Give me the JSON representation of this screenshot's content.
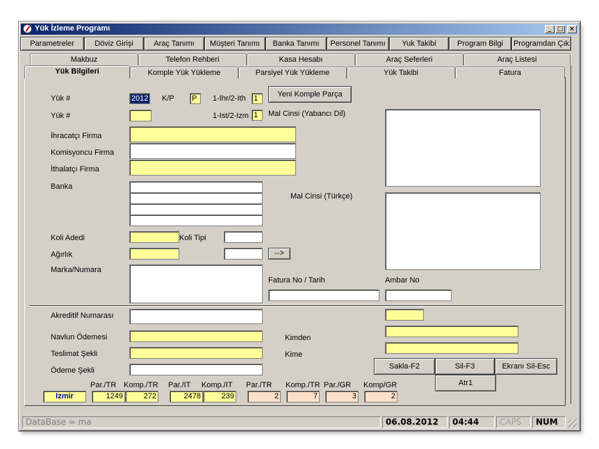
{
  "window": {
    "title": "Yük İzleme Programı",
    "minimize": "_",
    "maximize": "□",
    "close": "×"
  },
  "menu": [
    "Parametreler",
    "Döviz Girişi",
    "Araç Tanımı",
    "Müşteri Tanımı",
    "Banka Tanımı",
    "Personel Tanımı",
    "Yuk Takibi",
    "Program Bilgi",
    "Programdan Çık"
  ],
  "tabs_row1": [
    "Makbuz",
    "Telefon Rehberi",
    "Kasa Hesabı",
    "Araç Seferleri",
    "Araç Listesi"
  ],
  "tabs_row2": [
    "Yük Bilgileri",
    "Komple Yük Yükleme",
    "Parsiyel Yük Yükleme",
    "Yük Takibi",
    "Fatura"
  ],
  "form": {
    "yuk_no_label": "Yük #",
    "yuk_no_value": "2012",
    "kp_label": "K/P",
    "kp_value": "P",
    "ihr_ith_label": "1-Ihr/2-Ith",
    "ihr_ith_value": "1",
    "new_button": "Yeni Komple Parça",
    "yuk_no2_label": "Yük #",
    "ist_izm_label": "1-Ist/2-Izm",
    "ist_izm_value": "1",
    "mal_cinsi_yabanci_label": "Mal Cinsi (Yabancı Dil)",
    "ihracatci_label": "İhracatçı Firma",
    "komisyoncu_label": "Komisyoncu Firma",
    "ithalatci_label": "İthalatçı Firma",
    "banka_label": "Banka",
    "mal_cinsi_turkce_label": "Mal Cinsi (Türkçe)",
    "koli_adedi_label": "Koli Adedi",
    "koli_tipi_label": "Koli Tipi",
    "agirlik_label": "Ağırlık",
    "arrow_button": "-->",
    "marka_label": "Marka/Numara",
    "fatura_label": "Fatura No / Tarih",
    "ambar_label": "Ambar No",
    "akreditif_label": "Akreditif Numarası",
    "navlun_label": "Navlun Ödemesi",
    "kimden_label": "Kimden",
    "teslimat_label": "Teslimat Şekli",
    "kime_label": "Kime",
    "odeme_label": "Ödeme Şekli"
  },
  "buttons": {
    "sakla": "Sakla-F2",
    "sil": "Sil-F3",
    "ekrani_sil": "Ekranı Sil-Esc",
    "atr1": "Atr1"
  },
  "summary": {
    "city": "Izmir",
    "headers": [
      "Par./TR",
      "Komp./TR",
      "Par./IT",
      "Komp./IT",
      "Par./TR",
      "Komp./TR",
      "Par./GR",
      "Komp/GR"
    ],
    "values": [
      "1249",
      "272",
      "2478",
      "239",
      "2",
      "7",
      "3",
      "2"
    ]
  },
  "status": {
    "database": "DataBase = ma",
    "date": "06.08.2012",
    "time": "04:44",
    "caps": "CAPS",
    "num": "NUM"
  }
}
